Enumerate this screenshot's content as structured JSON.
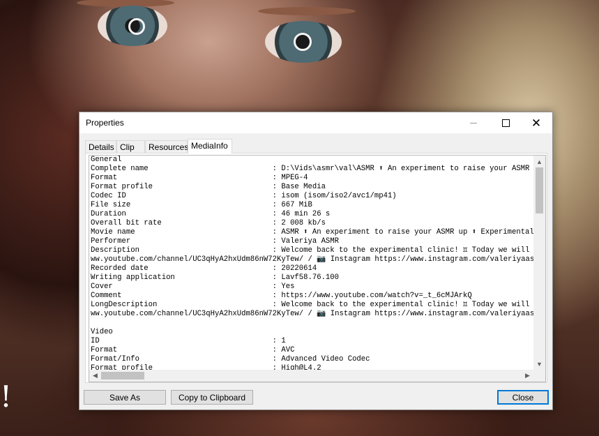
{
  "window": {
    "title": "Properties"
  },
  "tabs": [
    {
      "label": "Details",
      "active": false
    },
    {
      "label": "Clip",
      "active": false
    },
    {
      "label": "Resources",
      "active": false
    },
    {
      "label": "MediaInfo",
      "active": true
    }
  ],
  "mediainfo": {
    "lines": [
      "General",
      "Complete name                            : D:\\Vids\\asmr\\val\\ASMR ⬆ An experiment to raise your ASMR up ⬆ Experimental clinic for your",
      "Format                                   : MPEG-4",
      "Format profile                           : Base Media",
      "Codec ID                                 : isom (isom/iso2/avc1/mp41)",
      "File size                                : 667 MiB",
      "Duration                                 : 46 min 26 s",
      "Overall bit rate                         : 2 008 kb/s",
      "Movie name                               : ASMR ⬆ An experiment to raise your ASMR up ⬆ Experimental clinic for your",
      "Performer                                : Valeriya ASMR",
      "Description                              : Welcome back to the experimental clinic! ♊ Today we will check out how sensitive you",
      "ww.youtube.com/channel/UC3qHyA2hxUdm86nW72KyTew/ / 📷 Instagram https://www.instagram.com/valeriyaasmr/ / ",
      "Recorded date                            : 20220614",
      "Writing application                      : Lavf58.76.100",
      "Cover                                    : Yes",
      "Comment                                  : https://www.youtube.com/watch?v=_t_6cMJArkQ",
      "LongDescription                          : Welcome back to the experimental clinic! ♊ Today we will check out how sensitive you",
      "ww.youtube.com/channel/UC3qHyA2hxUdm86nW72KyTew/ / 📷 Instagram https://www.instagram.com/valeriyaasmr/ / ",
      "",
      "Video",
      "ID                                       : 1",
      "Format                                   : AVC",
      "Format/Info                              : Advanced Video Codec",
      "Format profile                           : High@L4.2"
    ]
  },
  "scrollbars": {
    "up_icon": "▲",
    "down_icon": "▼",
    "left_icon": "◀",
    "right_icon": "▶"
  },
  "buttons": {
    "save_as": "Save As",
    "copy": "Copy to Clipboard",
    "close": "Close"
  },
  "titlebar": {
    "close_glyph": "✕"
  },
  "background": {
    "mark": "!"
  },
  "colors": {
    "accent": "#0078d7",
    "dialog_bg": "#f0f0f0"
  }
}
